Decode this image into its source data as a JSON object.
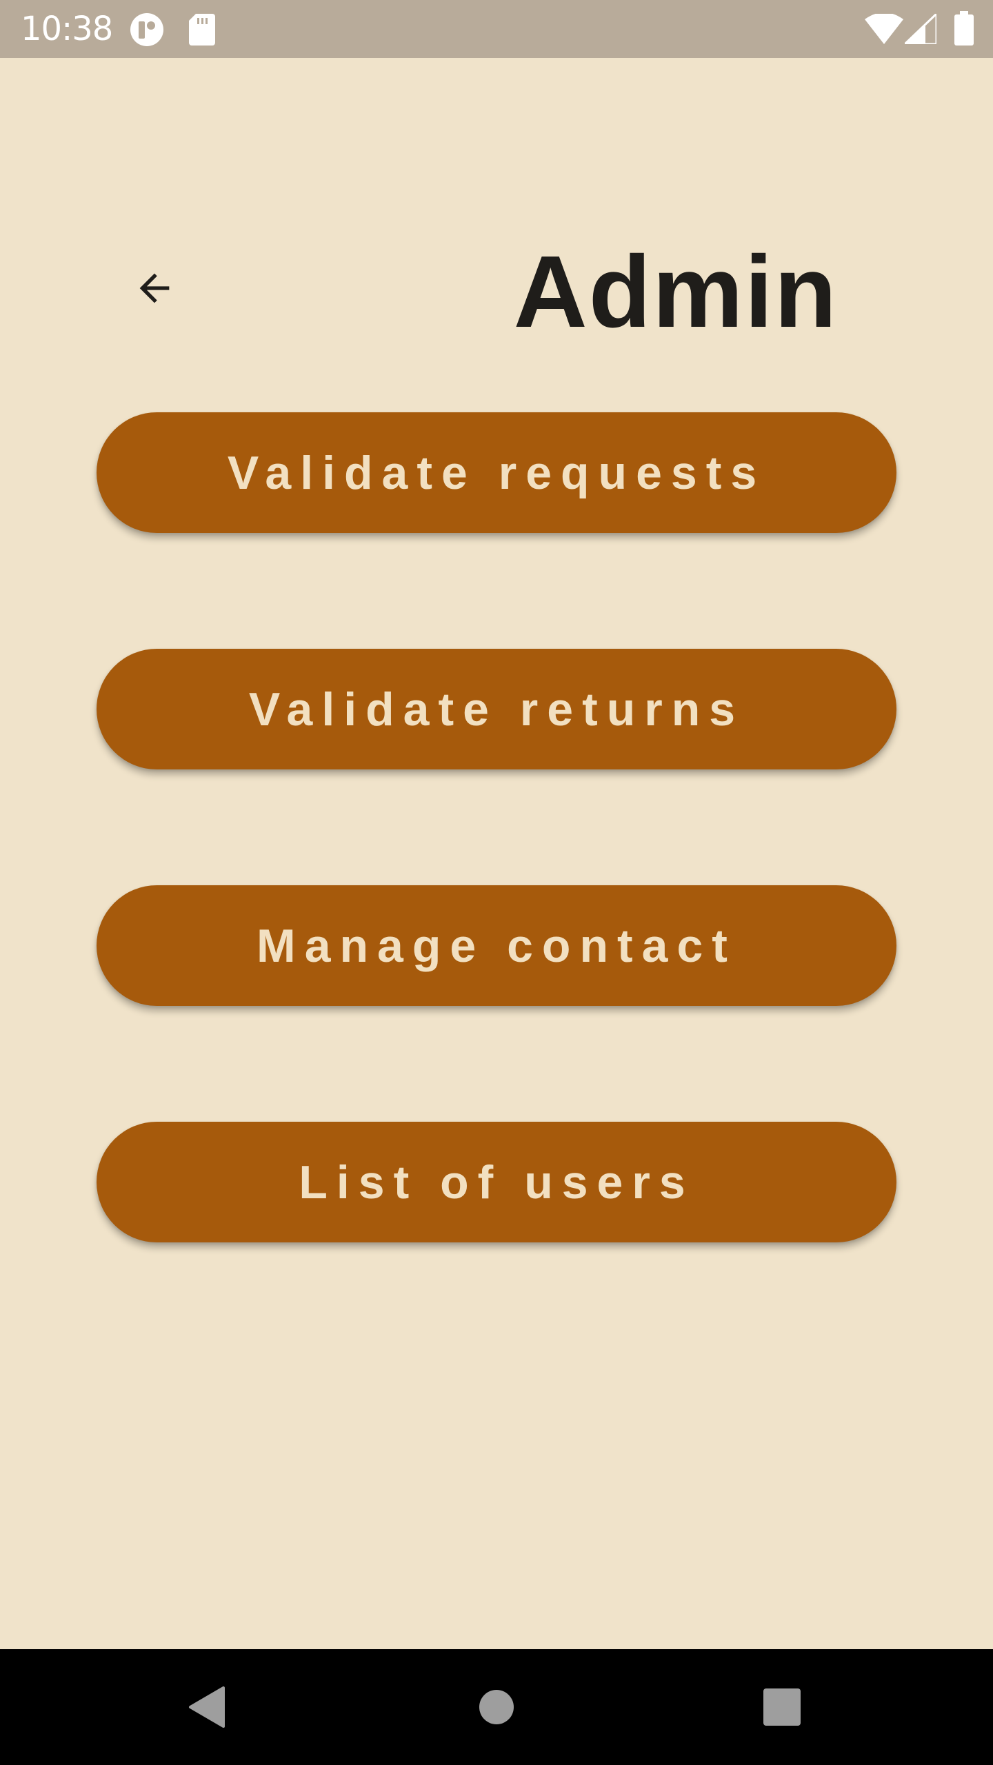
{
  "status_bar": {
    "time": "10:38",
    "icons_left": [
      "notification-app-icon",
      "sd-card-icon"
    ],
    "icons_right": [
      "wifi-icon",
      "cellular-signal-icon",
      "battery-icon"
    ]
  },
  "header": {
    "back_icon": "arrow-back-icon",
    "title": "Admin"
  },
  "menu": {
    "buttons": [
      {
        "label": "Validate requests"
      },
      {
        "label": "Validate returns"
      },
      {
        "label": "Manage contact"
      },
      {
        "label": "List of users"
      }
    ]
  },
  "nav_bar": {
    "icons": [
      "back-triangle-icon",
      "home-circle-icon",
      "recents-square-icon"
    ]
  },
  "colors": {
    "background": "#F0E3CA",
    "status_bar": "#B8AB9A",
    "button": "#A65A0C",
    "button_text": "#F2E0C1",
    "title": "#1F1D1A",
    "nav_bar": "#000000"
  }
}
